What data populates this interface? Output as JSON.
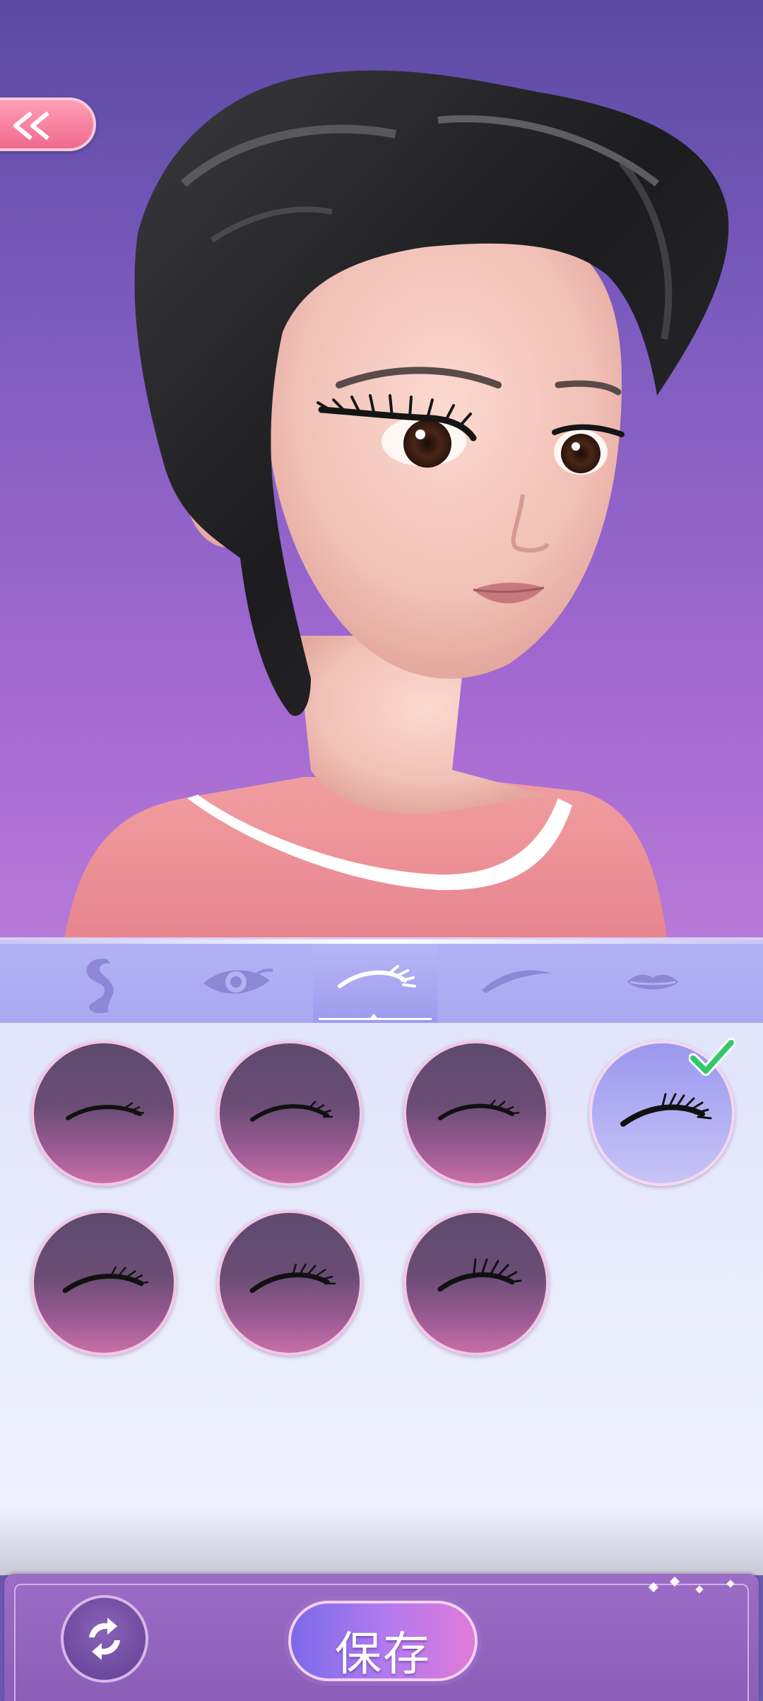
{
  "toolbar": {
    "back_icon": "double-chevron-left-icon"
  },
  "tabs": [
    {
      "name": "hair",
      "icon": "hair-icon",
      "active": false
    },
    {
      "name": "eyes",
      "icon": "eye-icon",
      "active": false
    },
    {
      "name": "eyelashes",
      "icon": "eyelash-icon",
      "active": true
    },
    {
      "name": "eyebrows",
      "icon": "eyebrow-icon",
      "active": false
    },
    {
      "name": "lips",
      "icon": "lips-icon",
      "active": false
    }
  ],
  "eyelash_options": [
    {
      "style": "lash-1",
      "selected": false
    },
    {
      "style": "lash-2",
      "selected": false
    },
    {
      "style": "lash-3",
      "selected": false
    },
    {
      "style": "lash-4",
      "selected": true
    },
    {
      "style": "lash-5",
      "selected": false
    },
    {
      "style": "lash-6",
      "selected": false
    },
    {
      "style": "lash-7",
      "selected": false
    }
  ],
  "bottom_bar": {
    "reset_icon": "refresh-icon",
    "save_label": "保存"
  },
  "colors": {
    "background_top": "#5a4aa4",
    "background_bottom": "#b77ad8",
    "tab_bar": "#aeadf3",
    "option_fill": "#6a4d75",
    "option_selected_fill": "#b5b3f4",
    "check": "#35c86a",
    "save_button": "#b07af0"
  }
}
